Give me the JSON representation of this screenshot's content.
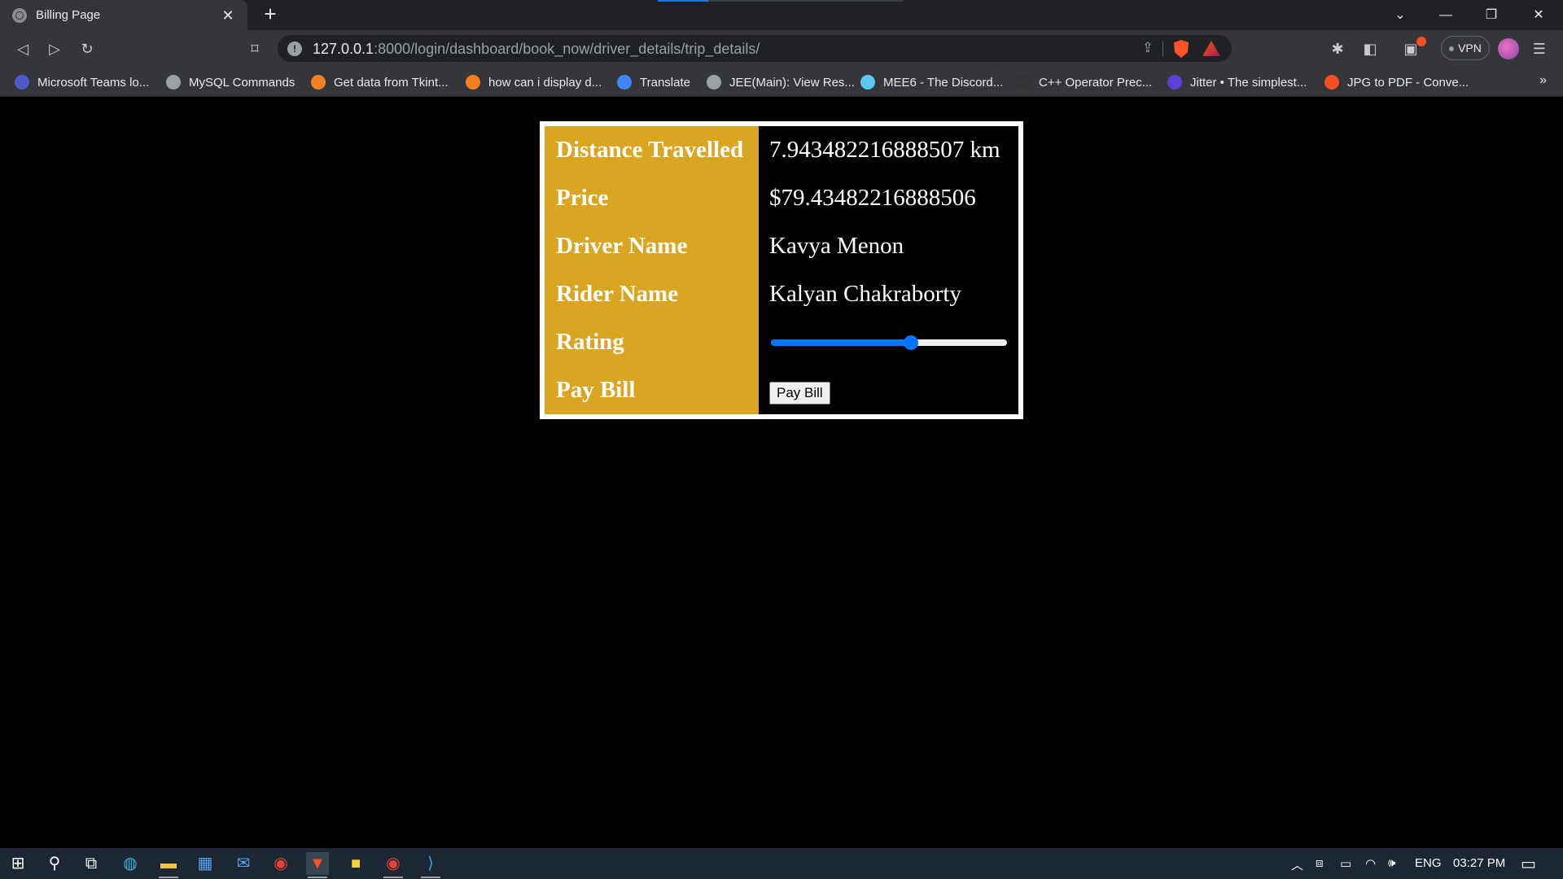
{
  "browser": {
    "tab_title": "Billing Page",
    "tab_close": "✕",
    "new_tab": "+",
    "url_host": "127.0.0.1",
    "url_rest": ":8000/login/dashboard/book_now/driver_details/trip_details/",
    "vpn_label": "VPN",
    "window_controls": [
      "⌄",
      "—",
      "❐",
      "✕"
    ],
    "bookmarks": [
      {
        "label": "Microsoft Teams lo...",
        "icon": "teams-icon",
        "color": "#5059c9"
      },
      {
        "label": "MySQL Commands",
        "icon": "globe-icon",
        "color": "#9aa0a6"
      },
      {
        "label": "Get data from Tkint...",
        "icon": "stackoverflow-icon",
        "color": "#f48024"
      },
      {
        "label": "how can i display d...",
        "icon": "stackoverflow-icon",
        "color": "#f48024"
      },
      {
        "label": "Translate",
        "icon": "translate-icon",
        "color": "#4285f4"
      },
      {
        "label": "JEE(Main): View Res...",
        "icon": "globe-icon",
        "color": "#9aa0a6"
      },
      {
        "label": "MEE6 - The Discord...",
        "icon": "mee6-icon",
        "color": "#5dc6f1"
      },
      {
        "label": "C++ Operator Prec...",
        "icon": "cppreference-icon",
        "color": "#333333"
      },
      {
        "label": "Jitter • The simplest...",
        "icon": "jitter-icon",
        "color": "#5d3fd3"
      },
      {
        "label": "JPG to PDF - Conve...",
        "icon": "jpg2pdf-icon",
        "color": "#f25022"
      }
    ],
    "bookmarks_more": "»"
  },
  "bill": {
    "rows": [
      {
        "label": "Distance Travelled",
        "value": "7.943482216888507 km"
      },
      {
        "label": "Price",
        "value": "$79.43482216888506"
      },
      {
        "label": "Driver Name",
        "value": "Kavya Menon"
      },
      {
        "label": "Rider Name",
        "value": "Kalyan Chakraborty"
      },
      {
        "label": "Rating",
        "value": ""
      },
      {
        "label": "Pay Bill",
        "value": ""
      }
    ],
    "rating_fraction": 0.6,
    "pay_button": "Pay Bill",
    "colors": {
      "label_bg": "#daa520",
      "slider": "#0075ff",
      "border": "#ffffff"
    }
  },
  "taskbar": {
    "lang": "ENG",
    "time": "03:27 PM"
  }
}
